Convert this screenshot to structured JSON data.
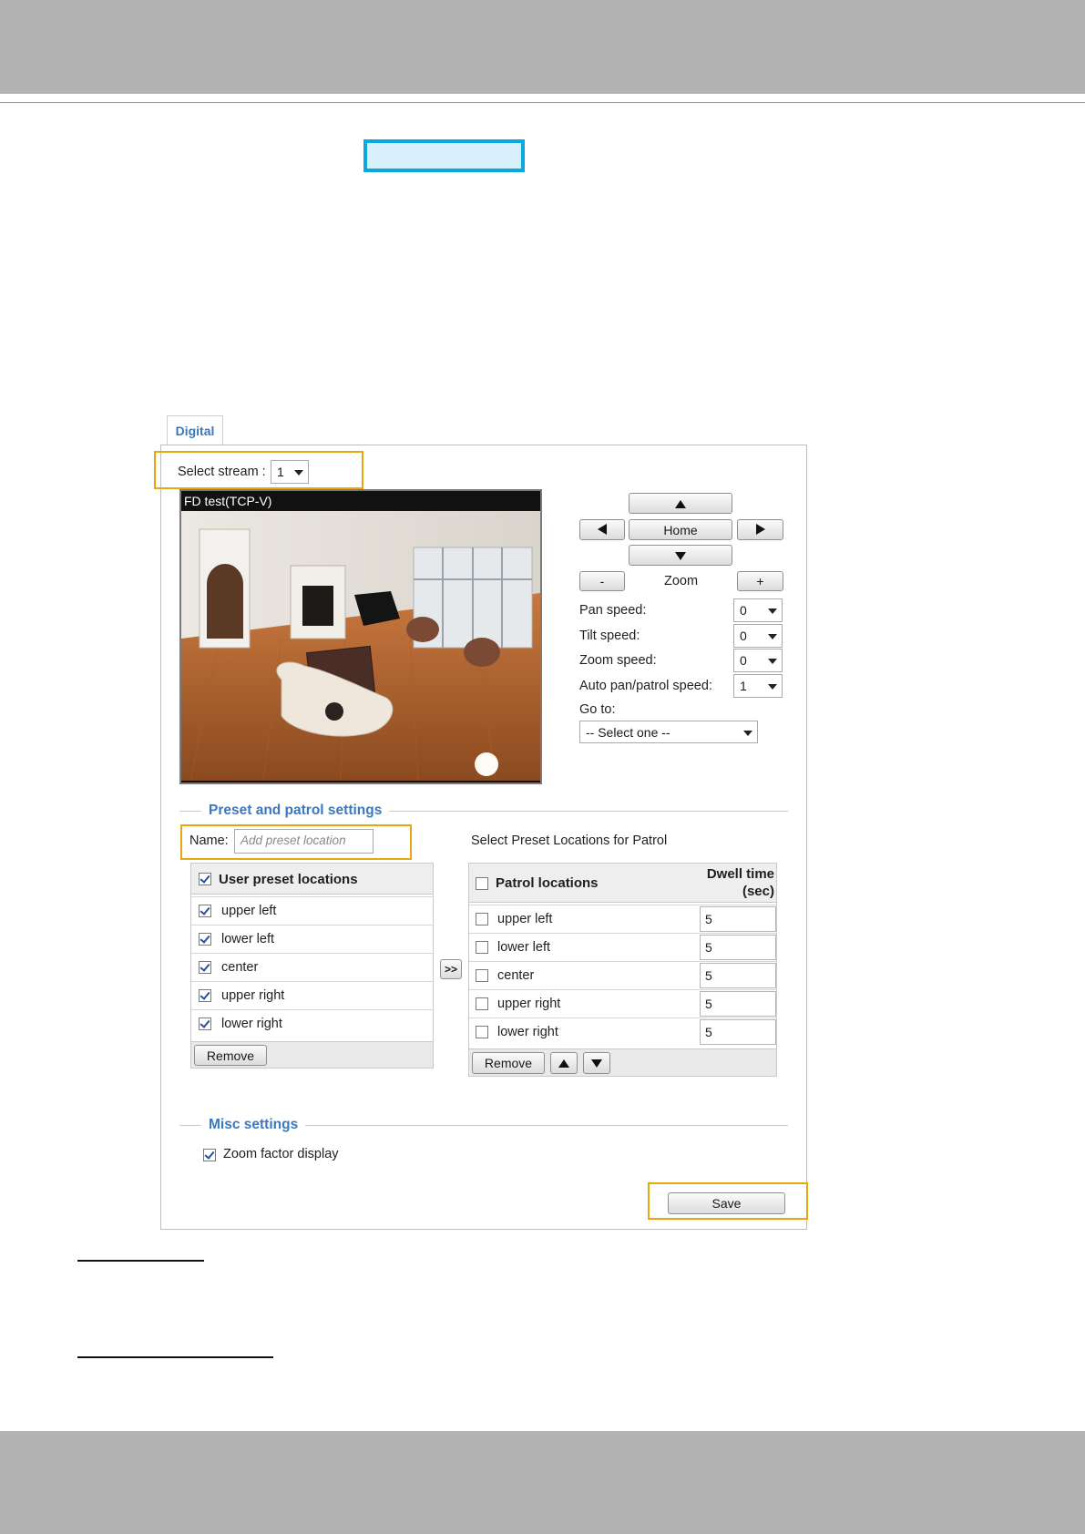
{
  "tab": {
    "label": "Digital"
  },
  "stream": {
    "label": "Select stream :",
    "value": "1"
  },
  "video": {
    "title": "FD test(TCP-V)"
  },
  "ptz": {
    "home_label": "Home",
    "zoom_label": "Zoom",
    "zoom_minus": "-",
    "zoom_plus": "+",
    "pan_speed": {
      "label": "Pan speed:",
      "value": "0"
    },
    "tilt_speed": {
      "label": "Tilt speed:",
      "value": "0"
    },
    "zoom_speed": {
      "label": "Zoom speed:",
      "value": "0"
    },
    "auto_pan_speed": {
      "label": "Auto pan/patrol speed:",
      "value": "1"
    },
    "goto": {
      "label": "Go to:",
      "value": "-- Select one --"
    }
  },
  "preset": {
    "section_title": "Preset and patrol settings",
    "name_label": "Name:",
    "name_placeholder": "Add preset location",
    "patrol_caption": "Select Preset Locations for Patrol",
    "user_header": "User preset locations",
    "user_items": [
      "upper left",
      "lower left",
      "center",
      "upper right",
      "lower right"
    ],
    "transfer_label": ">>",
    "remove_label": "Remove",
    "patrol_header": "Patrol locations",
    "dwell_header_1": "Dwell time",
    "dwell_header_2": "(sec)",
    "patrol_items": [
      {
        "label": "upper left",
        "dwell": "5"
      },
      {
        "label": "lower left",
        "dwell": "5"
      },
      {
        "label": "center",
        "dwell": "5"
      },
      {
        "label": "upper right",
        "dwell": "5"
      },
      {
        "label": "lower right",
        "dwell": "5"
      }
    ],
    "patrol_remove_label": "Remove"
  },
  "misc": {
    "section_title": "Misc settings",
    "zoom_factor_label": "Zoom factor display"
  },
  "save_label": "Save",
  "colors": {
    "accent_blue": "#3b78bd",
    "callout_orange": "#e8a70c",
    "highlight_cyan": "#0aa7e0"
  }
}
